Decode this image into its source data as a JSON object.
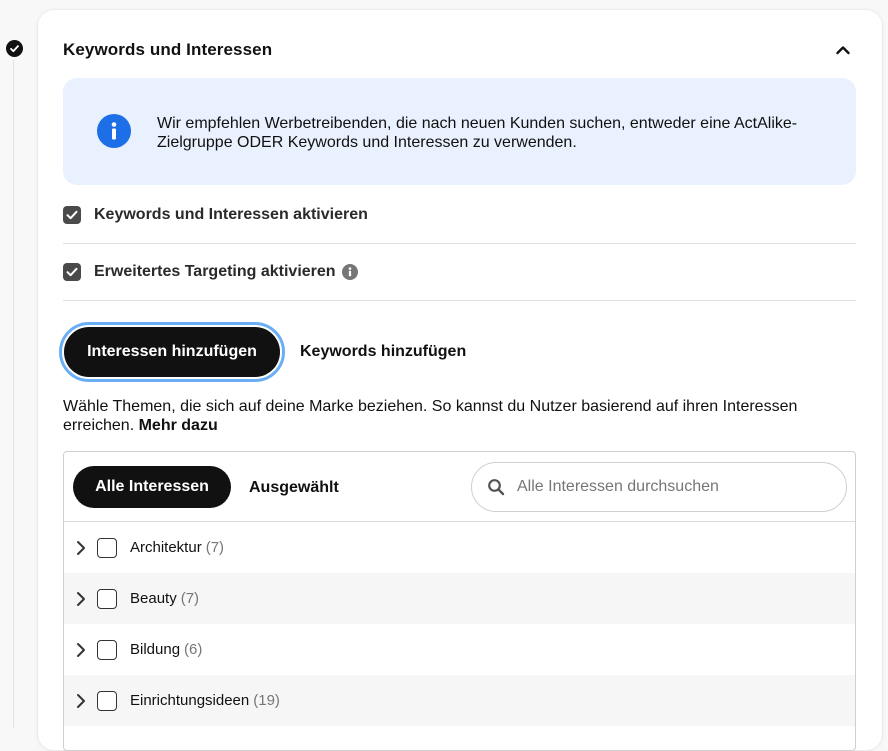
{
  "section": {
    "title": "Keywords und Interessen"
  },
  "info_box": {
    "text": "Wir empfehlen Werbetreibenden, die nach neuen Kunden suchen, entweder eine ActAlike-Zielgruppe ODER Keywords und Interessen zu verwenden."
  },
  "checkboxes": [
    {
      "label": "Keywords und Interessen aktivieren",
      "checked": true
    },
    {
      "label": "Erweitertes Targeting aktivieren",
      "checked": true
    }
  ],
  "tabs": {
    "active": "Interessen hinzufügen",
    "inactive": "Keywords hinzufügen"
  },
  "description": {
    "text": "Wähle Themen, die sich auf deine Marke beziehen. So kannst du Nutzer basierend auf ihren Interessen erreichen. ",
    "link": "Mehr dazu"
  },
  "panel": {
    "filter_all": "Alle Interessen",
    "filter_selected": "Ausgewählt",
    "search_placeholder": "Alle Interessen durchsuchen"
  },
  "interests": [
    {
      "label": "Architektur",
      "count": "(7)"
    },
    {
      "label": "Beauty",
      "count": "(7)"
    },
    {
      "label": "Bildung",
      "count": "(6)"
    },
    {
      "label": "Einrichtungsideen",
      "count": "(19)"
    }
  ],
  "colors": {
    "info_bg": "#e8f1fd",
    "info_icon": "#1d6fe8",
    "focus_ring": "#6aaef5",
    "primary_dark": "#111111"
  }
}
